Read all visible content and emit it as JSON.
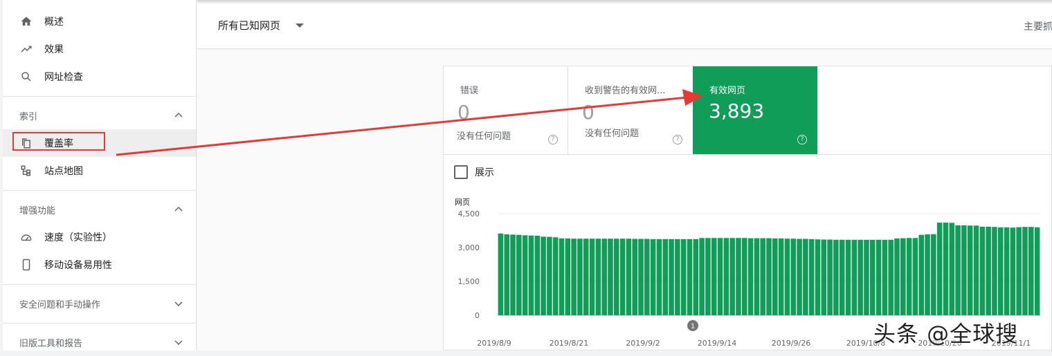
{
  "sidebar": {
    "items": [
      {
        "label": "概述",
        "icon": "home-icon"
      },
      {
        "label": "效果",
        "icon": "trending-up-icon"
      },
      {
        "label": "网址检查",
        "icon": "search-icon"
      }
    ],
    "sections": [
      {
        "label": "索引",
        "expanded": true,
        "items": [
          {
            "label": "覆盖率",
            "icon": "copy-pages-icon",
            "active": true
          },
          {
            "label": "站点地图",
            "icon": "sitemap-icon"
          }
        ]
      },
      {
        "label": "增强功能",
        "expanded": true,
        "items": [
          {
            "label": "速度（实验性）",
            "icon": "speedometer-icon"
          },
          {
            "label": "移动设备易用性",
            "icon": "phone-icon"
          }
        ]
      },
      {
        "label": "安全问题和手动操作",
        "expanded": false
      },
      {
        "label": "旧版工具和报告",
        "expanded": false
      }
    ]
  },
  "topbar": {
    "dropdown_label": "所有已知网页",
    "right_text": "主要抓"
  },
  "tiles": [
    {
      "title": "错误",
      "value": "0",
      "sub": "没有任何问题"
    },
    {
      "title": "收到警告的有效网...",
      "value": "0",
      "sub": "没有任何问题"
    },
    {
      "title": "有效网页",
      "value": "3,893",
      "sub": ""
    }
  ],
  "checkbox": {
    "label": "展示",
    "checked": false
  },
  "colors": {
    "accent_green": "#0f9d58",
    "annotation_red": "#e53935"
  },
  "chart_data": {
    "type": "bar",
    "ylabel": "网页",
    "ylim": [
      0,
      4500
    ],
    "yticks": [
      "4,500",
      "3,000",
      "1,500",
      "0"
    ],
    "x_tick_labels": [
      "2019/8/9",
      "2019/8/21",
      "2019/9/2",
      "2019/9/14",
      "2019/9/26",
      "2019/10/8",
      "2019/10/20",
      "2019/11/1"
    ],
    "annotation_marker": "1",
    "values": [
      3620,
      3580,
      3570,
      3560,
      3540,
      3530,
      3520,
      3480,
      3470,
      3450,
      3400,
      3400,
      3390,
      3390,
      3390,
      3390,
      3390,
      3390,
      3390,
      3390,
      3390,
      3390,
      3380,
      3380,
      3380,
      3370,
      3370,
      3370,
      3370,
      3370,
      3370,
      3370,
      3370,
      3420,
      3420,
      3420,
      3420,
      3420,
      3420,
      3420,
      3420,
      3410,
      3410,
      3410,
      3410,
      3400,
      3400,
      3390,
      3390,
      3380,
      3380,
      3370,
      3360,
      3350,
      3350,
      3340,
      3340,
      3340,
      3340,
      3340,
      3340,
      3340,
      3340,
      3340,
      3340,
      3400,
      3410,
      3420,
      3420,
      3560,
      3580,
      3590,
      4100,
      4100,
      4090,
      3980,
      3980,
      3970,
      3970,
      3920,
      3920,
      3910,
      3890,
      3890,
      3880,
      3900,
      3910,
      3910,
      3893
    ]
  },
  "watermark": "头条 @全球搜"
}
